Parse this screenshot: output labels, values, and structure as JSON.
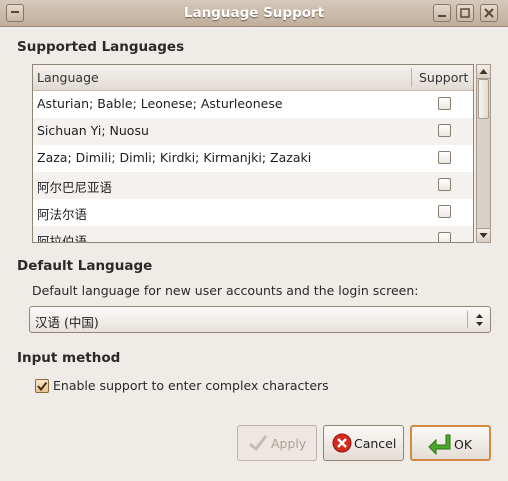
{
  "window": {
    "title": "Language Support"
  },
  "supported": {
    "heading": "Supported Languages",
    "columns": {
      "language": "Language",
      "support": "Support"
    },
    "rows": [
      {
        "name": "Asturian; Bable; Leonese; Asturleonese",
        "checked": false
      },
      {
        "name": "Sichuan Yi; Nuosu",
        "checked": false
      },
      {
        "name": "Zaza; Dimili; Dimli; Kirdki; Kirmanjki; Zazaki",
        "checked": false
      },
      {
        "name": "阿尔巴尼亚语",
        "checked": false
      },
      {
        "name": "阿法尔语",
        "checked": false
      },
      {
        "name": "阿拉伯语",
        "checked": false
      }
    ]
  },
  "default_language": {
    "heading": "Default Language",
    "description": "Default language for new user accounts and the login screen:",
    "selected": "汉语 (中国)"
  },
  "input_method": {
    "heading": "Input method",
    "enable_label": "Enable support to enter complex characters",
    "enabled": true
  },
  "buttons": {
    "apply": {
      "label": "Apply",
      "enabled": false
    },
    "cancel": {
      "label": "Cancel"
    },
    "ok": {
      "label": "OK"
    }
  },
  "colors": {
    "accent_checkbox": "#e5c490",
    "ok_border": "#d38942",
    "cancel_icon": "#d62a1f",
    "ok_icon": "#4caa2b"
  },
  "icons": {
    "window_menu": "window-menu-icon",
    "minimize": "minimize-icon",
    "maximize": "maximize-icon",
    "close": "close-icon",
    "apply": "apply-check-icon",
    "cancel": "cancel-icon",
    "ok": "ok-enter-icon"
  }
}
